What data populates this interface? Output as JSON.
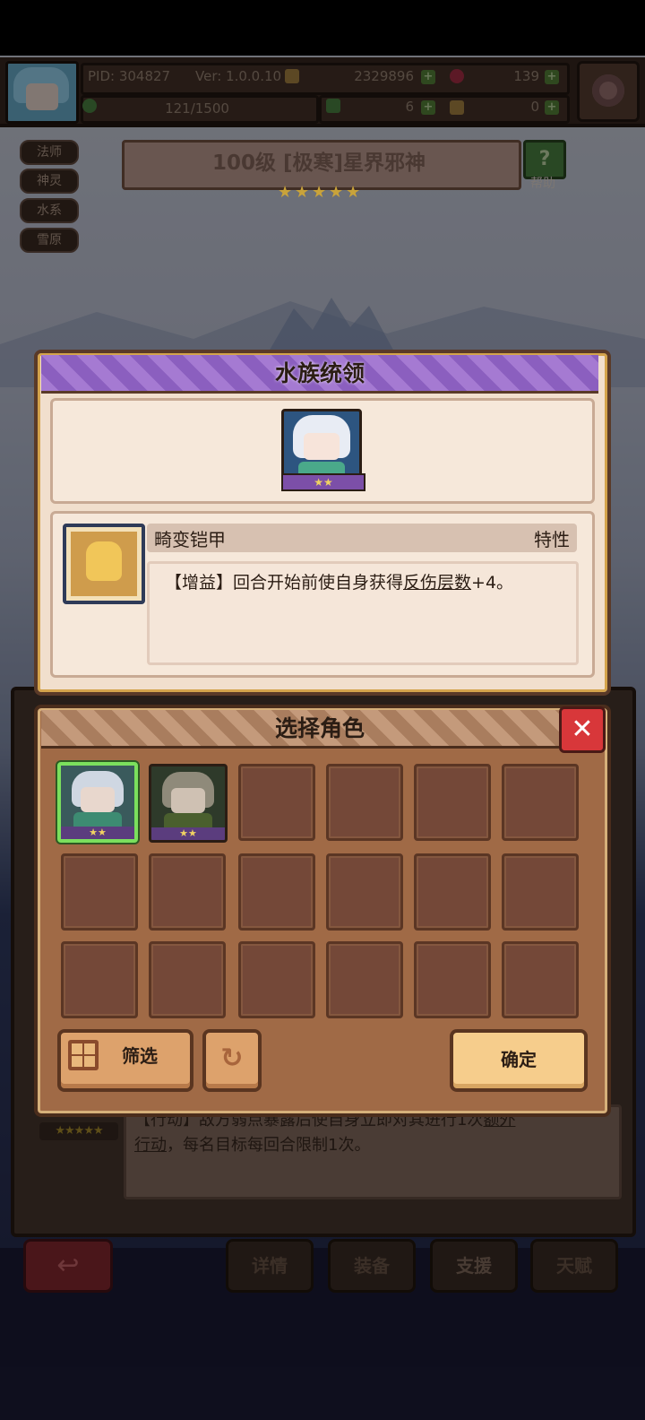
{
  "hud": {
    "pid": "PID: 304827",
    "version": "Ver: 1.0.0.10",
    "coins": "2329896",
    "gems": "139",
    "clovers": "6",
    "keys": "0",
    "stamina": "121/1500"
  },
  "tags": [
    "法师",
    "神灵",
    "水系",
    "雪原"
  ],
  "boss": {
    "title": "100级 [极寒]星界邪神",
    "stars": 5,
    "help_label": "帮助",
    "help_glyph": "?"
  },
  "trait_dialog": {
    "title": "水族统领",
    "hero_stars": "★★",
    "trait_name": "畸变铠甲",
    "trait_type": "特性",
    "desc_pre": "【增益】回合开始前使自身获得",
    "desc_link": "反伤层数",
    "desc_post": "+4。"
  },
  "under_panel": {
    "stars": "★★★★★",
    "line1_pre": "【行动】敌方弱点暴露后使自身立即对其进行1次",
    "line1_link": "额外",
    "line2_link": "行动",
    "line2_post": "，每名目标每回合限制1次。"
  },
  "select_dialog": {
    "title": "选择角色",
    "close_glyph": "✕",
    "filter_label": "筛选",
    "refresh_glyph": "↻",
    "confirm_label": "确定",
    "hero1_stars": "★★",
    "hero2_stars": "★★"
  },
  "nav": {
    "back_glyph": "↩",
    "details": "详情",
    "equipment": "装备",
    "support": "支援",
    "talent": "天赋"
  },
  "colors": {
    "selected_outline": "#7be05d",
    "close_red": "#d8373a",
    "purple_header": "#a57ad2"
  }
}
